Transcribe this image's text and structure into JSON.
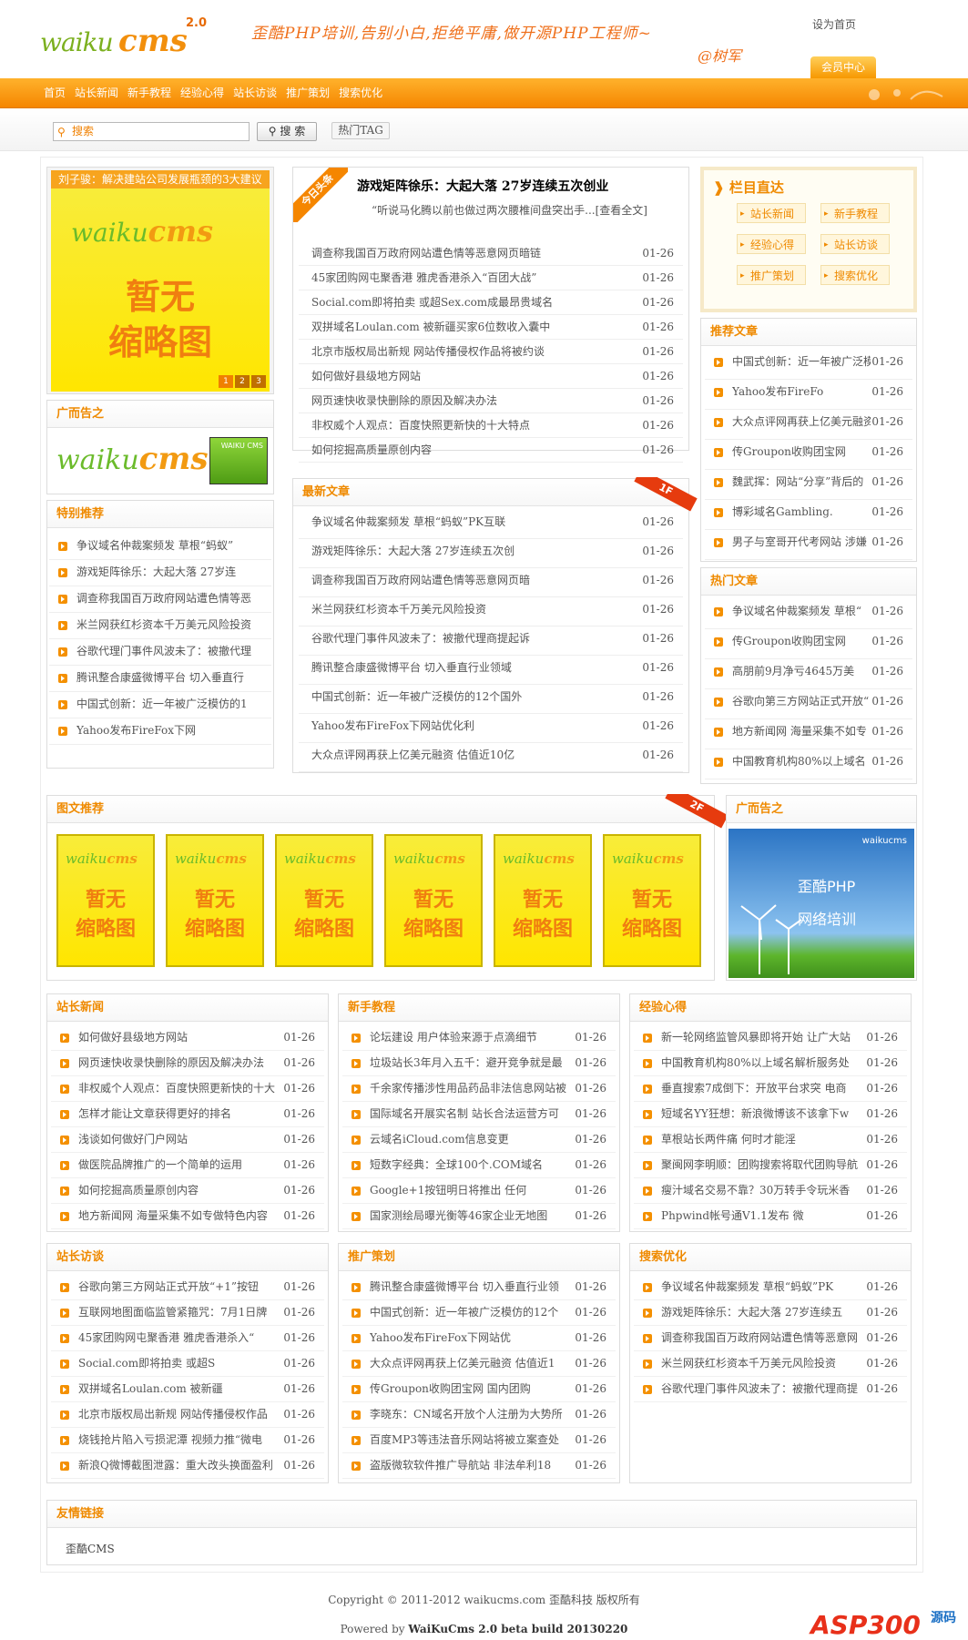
{
  "header": {
    "logo_text_1": "waiku",
    "logo_text_2": "cms",
    "logo_version": "2.0",
    "slogan": "歪酷PHP培训,告别小白,拒绝平庸,做开源PHP工程师~",
    "slogan_sign": "@树军",
    "set_home": "设为首页",
    "member_center": "会员中心"
  },
  "nav": [
    "首页",
    "站长新闻",
    "新手教程",
    "经验心得",
    "站长访谈",
    "推广策划",
    "搜索优化"
  ],
  "search": {
    "placeholder": "搜索",
    "button": "搜 索",
    "hot_tag": "热门TAG"
  },
  "slide": {
    "caption": "刘子骏：解决建站公司发展瓶颈的3大建议",
    "thumb_line1": "暂无",
    "thumb_line2": "缩略图",
    "pages": [
      "1",
      "2",
      "3"
    ]
  },
  "ad_left": {
    "title": "广而告之",
    "logo_1": "waiku",
    "logo_2": "cms",
    "box_text": "WAIKU CMS"
  },
  "special": {
    "title": "特别推荐",
    "items": [
      "争议域名仲裁案频发 草根“蚂蚁”",
      "游戏矩阵徐乐：大起大落 27岁连",
      "调查称我国百万政府网站遭色情等恶",
      "米兰网获红杉资本千万美元风险投资",
      "谷歌代理门事件风波未了：被撤代理",
      "腾讯整合康盛微博平台 切入垂直行",
      "中国式创新：近一年被广泛模仿的1",
      "Yahoo发布FireFox下网"
    ]
  },
  "headline": {
    "ribbon": "今日头条",
    "title": "游戏矩阵徐乐：大起大落 27岁连续五次创业",
    "summary": "“听说马化腾以前也做过两次腰椎间盘突出手...[查看全文]",
    "items": [
      [
        "调查称我国百万政府网站遭色情等恶意网页暗链",
        "01-26"
      ],
      [
        "45家团购网屯聚香港 雅虎香港杀入“百团大战”",
        "01-26"
      ],
      [
        "Social.com即将拍卖 或超Sex.com成最昂贵域名",
        "01-26"
      ],
      [
        "双拼域名Loulan.com 被新疆买家6位数收入囊中",
        "01-26"
      ],
      [
        "北京市版权局出新规 网站传播侵权作品将被约谈",
        "01-26"
      ],
      [
        "如何做好县级地方网站",
        "01-26"
      ],
      [
        "网页速快收录快删除的原因及解决办法",
        "01-26"
      ],
      [
        "非权威个人观点：百度快照更新快的十大特点",
        "01-26"
      ],
      [
        "如何挖掘高质量原创内容",
        "01-26"
      ]
    ]
  },
  "latest": {
    "title": "最新文章",
    "ribbon": "1F",
    "items": [
      [
        "争议域名仲裁案频发 草根“蚂蚁”PK互联",
        "01-26"
      ],
      [
        "游戏矩阵徐乐：大起大落 27岁连续五次创",
        "01-26"
      ],
      [
        "调查称我国百万政府网站遭色情等恶意网页暗",
        "01-26"
      ],
      [
        "米兰网获红杉资本千万美元风险投资",
        "01-26"
      ],
      [
        "谷歌代理门事件风波未了：被撤代理商提起诉",
        "01-26"
      ],
      [
        "腾讯整合康盛微博平台 切入垂直行业领域",
        "01-26"
      ],
      [
        "中国式创新：近一年被广泛模仿的12个国外",
        "01-26"
      ],
      [
        "Yahoo发布FireFox下网站优化利",
        "01-26"
      ],
      [
        "大众点评网再获上亿美元融资 估值近10亿",
        "01-26"
      ]
    ]
  },
  "column": {
    "title": "栏目直达",
    "links": [
      "站长新闻",
      "新手教程",
      "经验心得",
      "站长访谈",
      "推广策划",
      "搜索优化"
    ]
  },
  "recommend": {
    "title": "推荐文章",
    "items": [
      [
        "中国式创新：近一年被广泛模",
        "01-26"
      ],
      [
        "Yahoo发布FireFo",
        "01-26"
      ],
      [
        "大众点评网再获上亿美元融资",
        "01-26"
      ],
      [
        "传Groupon收购团宝网",
        "01-26"
      ],
      [
        "魏武挥：网站“分享”背后的",
        "01-26"
      ],
      [
        "博彩域名Gambling.",
        "01-26"
      ],
      [
        "男子与室哥开代考网站 涉嫌",
        "01-26"
      ]
    ]
  },
  "hot": {
    "title": "热门文章",
    "items": [
      [
        "争议域名仲裁案频发 草根“",
        "01-26"
      ],
      [
        "传Groupon收购团宝网",
        "01-26"
      ],
      [
        "高朋前9月净亏4645万美",
        "01-26"
      ],
      [
        "谷歌向第三方网站正式开放“",
        "01-26"
      ],
      [
        "地方新闻网 海量采集不如专",
        "01-26"
      ],
      [
        "中国教育机构80%以上域名",
        "01-26"
      ]
    ]
  },
  "pic": {
    "title": "图文推荐",
    "ribbon": "2F",
    "count_label": "6",
    "thumb_line1": "暂无",
    "thumb_line2": "缩略图"
  },
  "ad_right": {
    "title": "广而告之",
    "brand": "waikucms",
    "line1": "歪酷PHP",
    "line2": "网络培训"
  },
  "sections": [
    {
      "title": "站长新闻",
      "items": [
        [
          "如何做好县级地方网站",
          "01-26"
        ],
        [
          "网页速快收录快删除的原因及解决办法",
          "01-26"
        ],
        [
          "非权威个人观点：百度快照更新快的十大",
          "01-26"
        ],
        [
          "怎样才能让文章获得更好的排名",
          "01-26"
        ],
        [
          "浅谈如何做好门户网站",
          "01-26"
        ],
        [
          "做医院品牌推广的一个简单的运用",
          "01-26"
        ],
        [
          "如何挖掘高质量原创内容",
          "01-26"
        ],
        [
          "地方新闻网 海量采集不如专做特色内容",
          "01-26"
        ]
      ]
    },
    {
      "title": "新手教程",
      "items": [
        [
          "论坛建设 用户体验来源于点滴细节",
          "01-26"
        ],
        [
          "垃圾站长3年月入五千：避开竞争就是最",
          "01-26"
        ],
        [
          "千余家传播涉性用品药品非法信息网站被",
          "01-26"
        ],
        [
          "国际域名开展实名制 站长合法运营方可",
          "01-26"
        ],
        [
          "云域名iCloud.com信息变更",
          "01-26"
        ],
        [
          "短数字经典：全球100个.COM域名",
          "01-26"
        ],
        [
          "Google+1按钮明日将推出 任何",
          "01-26"
        ],
        [
          "国家测绘局曝光衡等46家企业无地图",
          "01-26"
        ]
      ]
    },
    {
      "title": "经验心得",
      "items": [
        [
          "新一轮网络监管风暴即将开始 让广大站",
          "01-26"
        ],
        [
          "中国教育机构80%以上域名解析服务处",
          "01-26"
        ],
        [
          "垂直搜索7成倒下：开放平台求突 电商",
          "01-26"
        ],
        [
          "短域名YY狂想：新浪微博该不该拿下w",
          "01-26"
        ],
        [
          "草根站长两件痛 何时才能淫",
          "01-26"
        ],
        [
          "聚闽网李明顺：团购搜索将取代团购导航",
          "01-26"
        ],
        [
          "瘦汁域名交易不靠？30万转手令玩米香",
          "01-26"
        ],
        [
          "Phpwind帐号通V1.1发布 微",
          "01-26"
        ]
      ]
    },
    {
      "title": "站长访谈",
      "items": [
        [
          "谷歌向第三方网站正式开放“+1”按钮",
          "01-26"
        ],
        [
          "互联网地图面临监管紧箍咒：7月1日牌",
          "01-26"
        ],
        [
          "45家团购网屯聚香港 雅虎香港杀入“",
          "01-26"
        ],
        [
          "Social.com即将拍卖 或超S",
          "01-26"
        ],
        [
          "双拼域名Loulan.com 被新疆",
          "01-26"
        ],
        [
          "北京市版权局出新规 网站传播侵权作品",
          "01-26"
        ],
        [
          "烧钱抢片陷入亏损泥潭 视频力推“微电",
          "01-26"
        ],
        [
          "新浪Q微博截图泄露：重大改头换面盈利",
          "01-26"
        ]
      ]
    },
    {
      "title": "推广策划",
      "items": [
        [
          "腾讯整合康盛微博平台 切入垂直行业领",
          "01-26"
        ],
        [
          "中国式创新：近一年被广泛模仿的12个",
          "01-26"
        ],
        [
          "Yahoo发布FireFox下网站优",
          "01-26"
        ],
        [
          "大众点评网再获上亿美元融资 估值近1",
          "01-26"
        ],
        [
          "传Groupon收购团宝网 国内团购",
          "01-26"
        ],
        [
          "李晓东：CN域名开放个人注册为大势所",
          "01-26"
        ],
        [
          "百度MP3等违法音乐网站将被立案查处",
          "01-26"
        ],
        [
          "盗版微软软件推广导航站 非法牟利18",
          "01-26"
        ]
      ]
    },
    {
      "title": "搜索优化",
      "items": [
        [
          "争议域名仲裁案频发 草根“蚂蚁”PK",
          "01-26"
        ],
        [
          "游戏矩阵徐乐：大起大落 27岁连续五",
          "01-26"
        ],
        [
          "调查称我国百万政府网站遭色情等恶意网",
          "01-26"
        ],
        [
          "米兰网获红杉资本千万美元风险投资",
          "01-26"
        ],
        [
          "谷歌代理门事件风波未了：被撤代理商提",
          "01-26"
        ]
      ]
    }
  ],
  "links": {
    "title": "友情链接",
    "items": [
      "歪酷CMS"
    ]
  },
  "footer": {
    "copyright": "Copyright © 2011-2012 waikucms.com 歪酷科技 版权所有",
    "powered_prefix": "Powered by ",
    "powered": "WaiKuCms 2.0 beta build 20130220",
    "watermark": "ASP300",
    "watermark_sub": "源码"
  },
  "colors": {
    "accent": "#f58600",
    "title": "#ef8a00",
    "thumb": "#ffe600"
  }
}
